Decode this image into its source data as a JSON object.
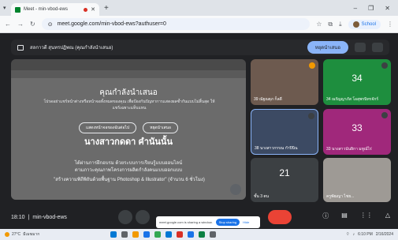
{
  "browser": {
    "tab_title": "Meet - min-vbod-ews",
    "url": "meet.google.com/min-vbod-ews?authuser=0",
    "profile_label": "School"
  },
  "banner": {
    "presenter_text": "สลกาวดี สุนทรปฏิพณ (คุณกำลังนำเสนอ)",
    "present_button": "หยุดนำเสนอ"
  },
  "share": {
    "overlay_title": "คุณกำลังนำเสนอ",
    "overlay_desc": "โปรดอย่าแชร์หน้าต่างหรือหน้าจอทั้งหมดของคุณ เพื่อป้องกันปัญหาการแสดงผลซ้ำกันแบบไม่สิ้นสุด ให้แชร์เฉพาะแท็บแทน",
    "btn_stop": "แสดงหน้าจอของฉันต่อไป",
    "btn_present": "หยุดนำเสนอ",
    "heading": "นางสาวกดดา คำนันนั้น",
    "body1": "ได้ผ่านการฝึกอบรม ด้วยระบบการเรียนรู้แบบออนไลน์",
    "body1b": "ตามภาวะคุณภาพโครงการผลิตกำลังคนแบบออกแบบ",
    "body2": "\"สร้างความพิถีพิถันด้วยพื้นฐาน Photoshop & Illustrator\" (จำนวน 6 ชั่วโมง)"
  },
  "tiles": [
    {
      "name": "39 ณัฐณฐุภ ก็ลดี",
      "label": ""
    },
    {
      "name": "34 ณรัญญาภัส โอสุพรนิทรจักร์",
      "label": "34"
    },
    {
      "name": "38 นางสาวกรรณ กำปินิน",
      "label": ""
    },
    {
      "name": "33 นางสาวนันยิกา มหูณ์ไร่",
      "label": "33"
    },
    {
      "name": "ชั้น 3 ตน",
      "label": "21"
    },
    {
      "name": "ครูพัฒญา ไชย...",
      "label": ""
    }
  ],
  "bottombar": {
    "time": "18:10",
    "meeting_code": "min-vbod-ews"
  },
  "sharing_bar": {
    "text": "meet.google.com is sharing a window.",
    "stop": "Stop sharing",
    "hide": "Hide"
  },
  "taskbar": {
    "temp": "27°C",
    "weather": "มีเมฆมาก",
    "time": "6:10 PM",
    "date": "2/16/2024"
  }
}
